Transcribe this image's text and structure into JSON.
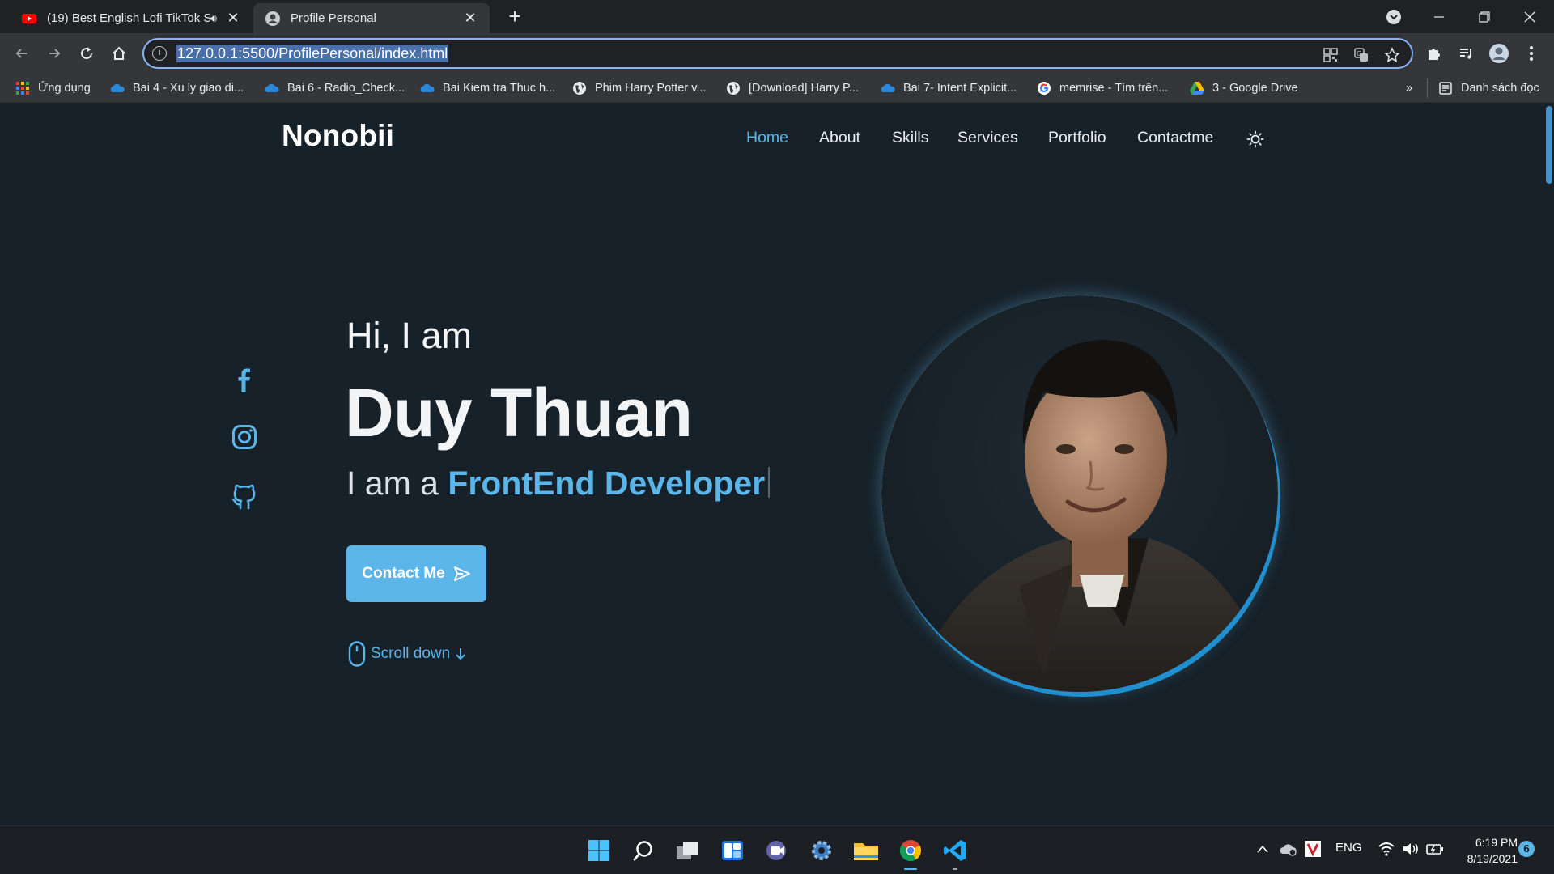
{
  "browser": {
    "tabs": [
      {
        "title": "(19) Best English Lofi TikTok S",
        "favicon": "youtube-icon",
        "audio": true
      },
      {
        "title": "Profile Personal",
        "favicon": "avatar-icon",
        "active": true
      }
    ],
    "url": "127.0.0.1:5500/ProfilePersonal/index.html",
    "bookmarks": [
      {
        "label": "Ứng dụng",
        "icon": "apps-grid-icon"
      },
      {
        "label": "Bai 4 - Xu ly giao di...",
        "icon": "onedrive-icon"
      },
      {
        "label": "Bai 6 - Radio_Check...",
        "icon": "onedrive-icon"
      },
      {
        "label": "Bai Kiem tra Thuc h...",
        "icon": "onedrive-icon"
      },
      {
        "label": "Phim Harry Potter v...",
        "icon": "globe-icon"
      },
      {
        "label": "[Download] Harry P...",
        "icon": "globe-icon"
      },
      {
        "label": "Bai 7- Intent Explicit...",
        "icon": "onedrive-icon"
      },
      {
        "label": "memrise - Tìm trên...",
        "icon": "google-icon"
      },
      {
        "label": "3 - Google Drive",
        "icon": "google-drive-icon"
      }
    ],
    "overflow": "»",
    "reading_list": "Danh sách đọc"
  },
  "site": {
    "logo": "Nonobii",
    "nav": [
      "Home",
      "About",
      "Skills",
      "Services",
      "Portfolio",
      "Contactme"
    ],
    "active_nav": "Home",
    "accent_color": "#5bb5e8",
    "background_color": "#172129",
    "hero": {
      "greeting": "Hi, I am",
      "name": "Duy Thuan",
      "role_prefix": "I am a",
      "role_highlight": "FrontEnd Developer",
      "cta": "Contact Me",
      "scroll": "Scroll down"
    },
    "social": [
      "facebook-icon",
      "instagram-icon",
      "github-icon"
    ]
  },
  "taskbar": {
    "language": "ENG",
    "time": "6:19 PM",
    "date": "8/19/2021",
    "notifications": "6"
  }
}
